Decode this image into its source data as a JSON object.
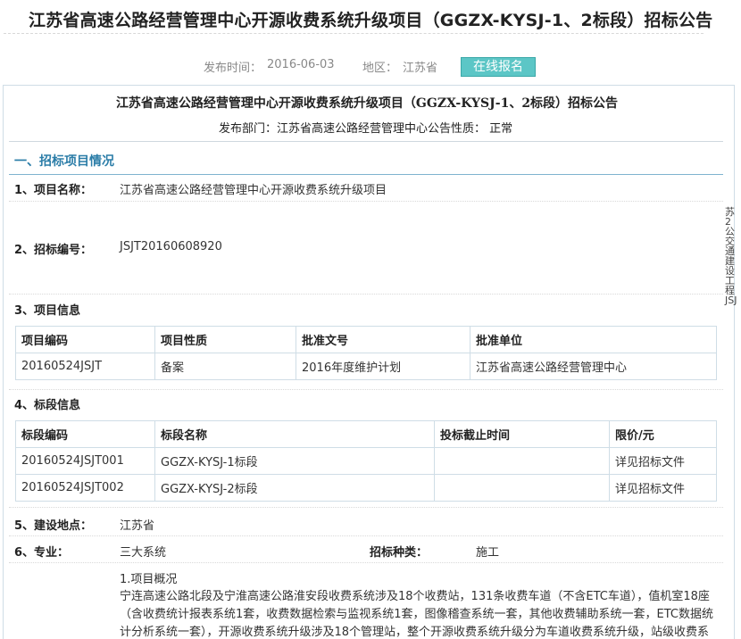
{
  "header": {
    "title": "江苏省高速公路经营管理中心开源收费系统升级项目（GGZX-KYSJ-1、2标段）招标公告",
    "publish_label": "发布时间：",
    "publish_date": "2016-06-03",
    "region_label": "地区：",
    "region": "江苏省",
    "register_button": "在线报名"
  },
  "doc": {
    "title": "江苏省高速公路经营管理中心开源收费系统升级项目（GGZX-KYSJ-1、2标段）招标公告",
    "dept_line": "发布部门：江苏省高速公路经营管理中心公告性质：  正常",
    "section1": "一、招标项目情况",
    "item1_label": "1、项目名称：",
    "item1_value": "江苏省高速公路经营管理中心开源收费系统升级项目",
    "item2_label": "2、招标编号：",
    "item2_value": "JSJT20160608920",
    "item3_label": "3、项目信息",
    "project_table": {
      "headers": [
        "项目编码",
        "项目性质",
        "批准文号",
        "批准单位"
      ],
      "rows": [
        [
          "20160524JSJT",
          "备案",
          "2016年度维护计划",
          "江苏省高速公路经营管理中心"
        ]
      ]
    },
    "item4_label": "4、标段信息",
    "section_table": {
      "headers": [
        "标段编码",
        "标段名称",
        "投标截止时间",
        "限价/元"
      ],
      "rows": [
        [
          "20160524JSJT001",
          "GGZX-KYSJ-1标段",
          "",
          "详见招标文件"
        ],
        [
          "20160524JSJT002",
          "GGZX-KYSJ-2标段",
          "",
          "详见招标文件"
        ]
      ]
    },
    "item5_label": "5、建设地点：",
    "item5_value": "江苏省",
    "item6_label": "6、专业：",
    "item6_value": "三大系统",
    "bid_type_label": "招标种类：",
    "bid_type_value": "施工",
    "desc_heading": "1.项目概况",
    "desc_line1": "宁连高速公路北段及宁淮高速公路淮安段收费系统涉及18个收费站，131条收费车道（不含ETC车道），值机室18座",
    "desc_line2": "（含收费统计报表系统1套，收费数据检索与监视系统1套，图像稽查系统一套，其他收费辅助系统一套，ETC数据统",
    "desc_line3": "计分析系统一套），开源收费系统升级涉及18个管理站，整个开源收费系统升级分为车道收费系统升级，站级收费系"
  },
  "side": {
    "text": "苏2公交通建设工程JSJ"
  }
}
